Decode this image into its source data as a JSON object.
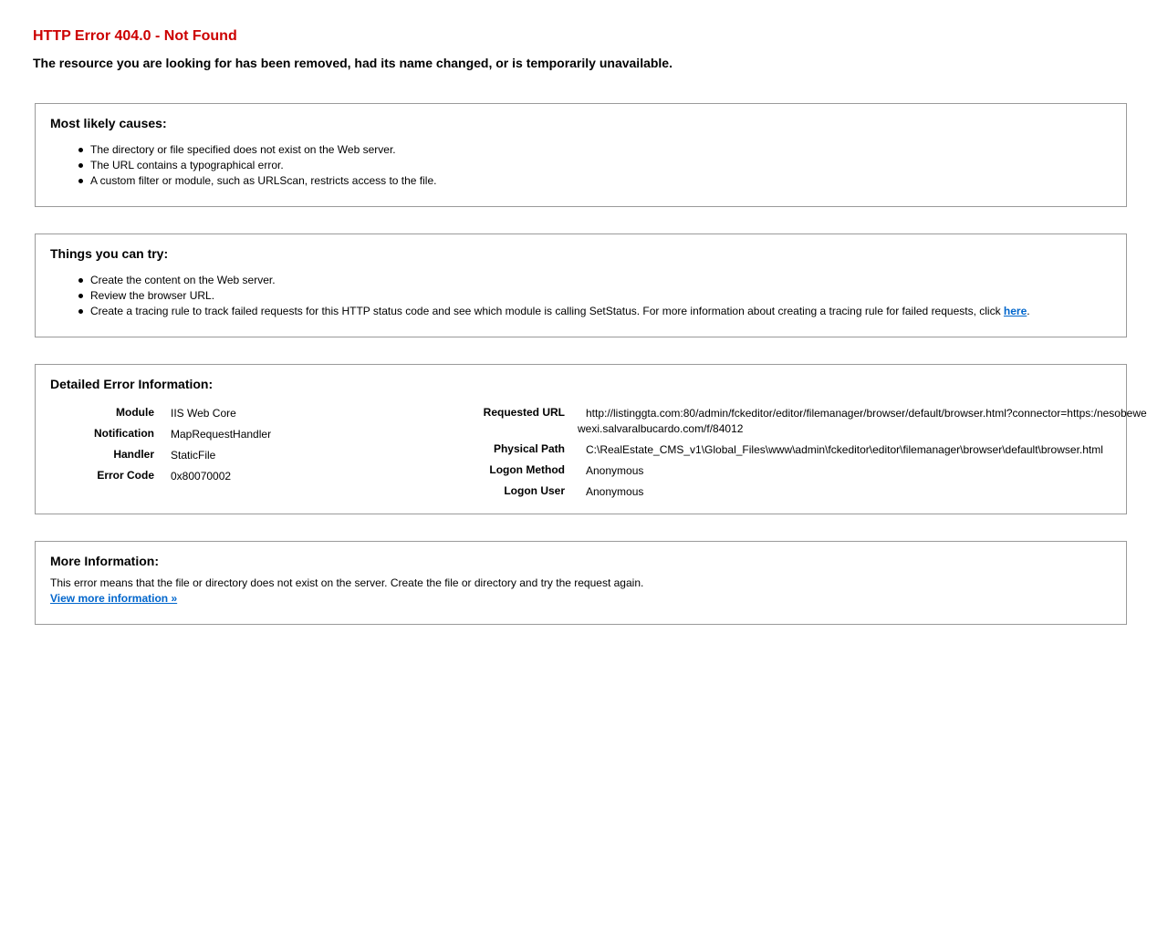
{
  "header": {
    "title": "HTTP Error 404.0 - Not Found",
    "subtitle": "The resource you are looking for has been removed, had its name changed, or is temporarily unavailable."
  },
  "causes": {
    "heading": "Most likely causes:",
    "items": [
      "The directory or file specified does not exist on the Web server.",
      "The URL contains a typographical error.",
      "A custom filter or module, such as URLScan, restricts access to the file."
    ]
  },
  "try": {
    "heading": "Things you can try:",
    "items": [
      "Create the content on the Web server.",
      "Review the browser URL."
    ],
    "tracing_text": "Create a tracing rule to track failed requests for this HTTP status code and see which module is calling SetStatus. For more information about creating a tracing rule for failed requests, click ",
    "tracing_link": "here",
    "tracing_suffix": "."
  },
  "details": {
    "heading": "Detailed Error Information:",
    "left": [
      {
        "label": "Module",
        "value": "IIS Web Core"
      },
      {
        "label": "Notification",
        "value": "MapRequestHandler"
      },
      {
        "label": "Handler",
        "value": "StaticFile"
      },
      {
        "label": "Error Code",
        "value": "0x80070002"
      }
    ],
    "right": [
      {
        "label": "Requested URL",
        "value": "http://listinggta.com:80/admin/fckeditor/editor/filemanager/browser/default/browser.html?connector=https:/nesobewe",
        "value2": "wexi.salvaralbucardo.com/f/84012"
      },
      {
        "label": "Physical Path",
        "value": "C:\\RealEstate_CMS_v1\\Global_Files\\www\\admin\\fckeditor\\editor\\filemanager\\browser\\default\\browser.html"
      },
      {
        "label": "Logon Method",
        "value": "Anonymous"
      },
      {
        "label": "Logon User",
        "value": "Anonymous"
      }
    ]
  },
  "more": {
    "heading": "More Information:",
    "text": "This error means that the file or directory does not exist on the server. Create the file or directory and try the request again.",
    "link": "View more information »"
  }
}
